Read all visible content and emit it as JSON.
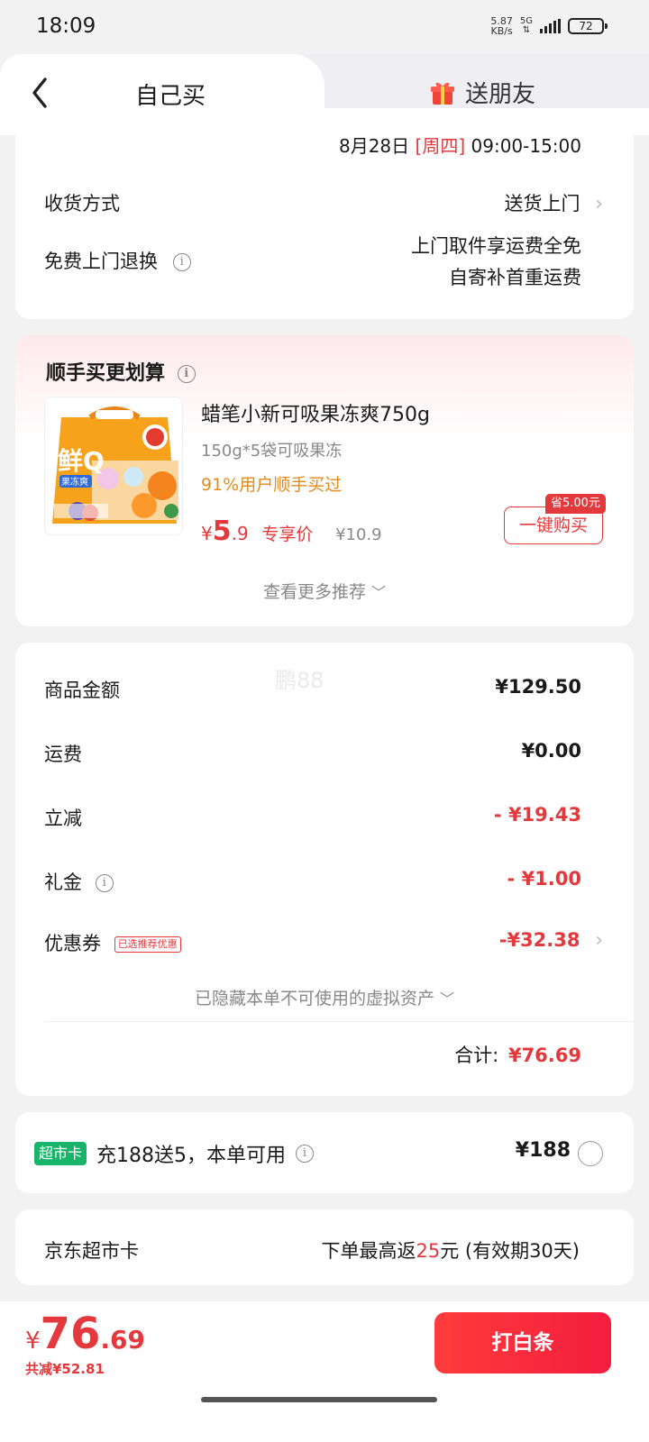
{
  "status_bar": {
    "time": "18:09",
    "net_speed_value": "5.87",
    "net_speed_unit": "KB/s",
    "network": "5G",
    "battery": "72"
  },
  "tabs": {
    "self_buy": "自己买",
    "gift": "送朋友"
  },
  "delivery": {
    "date": "8月28日",
    "weekday": "[周四]",
    "time_range": "09:00-15:00",
    "method_label": "收货方式",
    "method_value": "送货上门",
    "return_label": "免费上门退换",
    "return_line1": "上门取件享运费全免",
    "return_line2": "自寄补首重运费"
  },
  "recommend": {
    "section_title": "顺手买更划算",
    "product_title": "蜡笔小新可吸果冻爽750g",
    "spec": "150g*5袋可吸果冻",
    "social_proof": "91%用户顺手买过",
    "currency": "¥",
    "price_int": "5",
    "price_dec": ".9",
    "price_tag": "专享价",
    "original_price": "¥10.9",
    "save_badge": "省5.00元",
    "buy_button": "一键购买",
    "more": "查看更多推荐",
    "thumb_brand": "鲜Q",
    "thumb_sub": "果冻爽"
  },
  "summary": {
    "watermark": "鹏88",
    "goods_label": "商品金额",
    "goods_value": "¥129.50",
    "shipping_label": "运费",
    "shipping_value": "¥0.00",
    "discount_label": "立减",
    "discount_value": "- ¥19.43",
    "gift_label": "礼金",
    "gift_value": "- ¥1.00",
    "coupon_label": "优惠券",
    "coupon_tag": "已选推荐优惠",
    "coupon_value": "-¥32.38",
    "hidden_assets": "已隐藏本单不可使用的虚拟资产",
    "total_label": "合计:",
    "total_value": "¥76.69"
  },
  "supermarket_offer": {
    "tag": "超市卡",
    "text": "充188送5，本单可用",
    "price": "¥188"
  },
  "supermarket_card": {
    "label": "京东超市卡",
    "desc_prefix": "下单最高返",
    "desc_amount": "25",
    "desc_suffix": "元 (有效期30天)"
  },
  "bottom_bar": {
    "currency": "¥",
    "price_int": "76",
    "price_dec": ".69",
    "saved": "共减¥52.81",
    "pay_button": "打白条"
  },
  "colors": {
    "accent_red": "#e4393c",
    "offer_green": "#19b36b"
  }
}
